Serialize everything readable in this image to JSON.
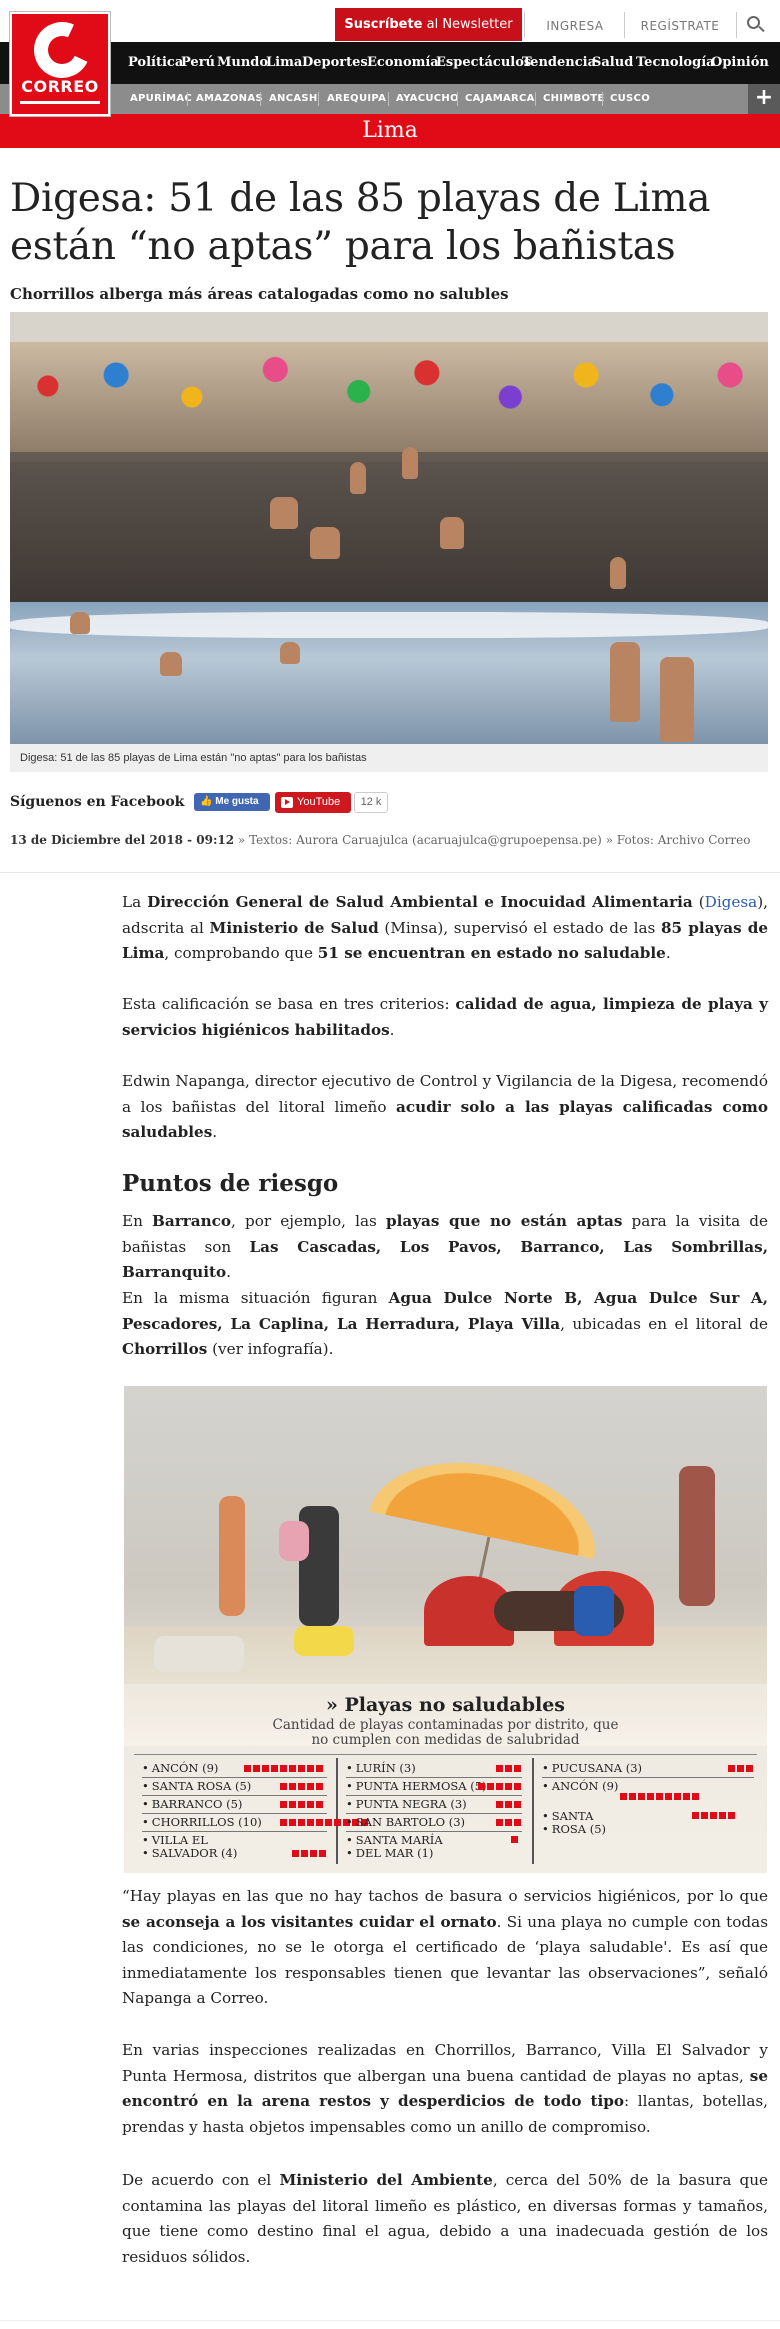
{
  "brand": {
    "name": "CORREO",
    "letter": "C"
  },
  "topbar": {
    "newsletter_strong": "Suscríbete",
    "newsletter_rest": " al Newsletter",
    "login": "INGRESA",
    "register": "REGÍSTRATE"
  },
  "nav": {
    "items": [
      "Política",
      "Perú",
      "Mundo",
      "Lima",
      "Deportes",
      "Economía",
      "Espectáculos",
      "Tendencia",
      "Salud",
      "Tecnología",
      "Opinión"
    ]
  },
  "subnav": {
    "items": [
      "APURÍMAC",
      "AMAZONAS",
      "ANCASH",
      "AREQUIPA",
      "AYACUCHO",
      "CAJAMARCA",
      "CHIMBOTE",
      "CUSCO"
    ],
    "more": "+"
  },
  "section": "Lima",
  "article": {
    "headline": "Digesa: 51 de las 85 playas de Lima están “no aptas” para los bañistas",
    "subhead": "Chorrillos alberga más áreas catalogadas como no salubles",
    "photo_caption": "Digesa: 51 de las 85 playas de Lima están \"no aptas\" para los bañistas",
    "follow_label": "Síguenos en Facebook",
    "fb_like": "Me gusta",
    "youtube_label": "YouTube",
    "youtube_count": "12 k",
    "date": "13 de Diciembre del 2018 - 09:12",
    "byline_rest": " » Textos: Aurora Caruajulca (acaruajulca@grupoepensa.pe) » Fotos: Archivo Correo",
    "h2": "Puntos de riesgo"
  },
  "paragraphs": {
    "p1": {
      "a": "La ",
      "b": "Dirección General de Salud Ambiental e Inocuidad Alimentaria",
      "c": " (",
      "link": "Digesa",
      "d": "), adscrita al ",
      "e": "Ministerio de Salud",
      "f": " (Minsa), supervisó el estado de las ",
      "g": "85 playas de Lima",
      "h": ", comprobando que ",
      "i": "51 se encuentran en estado no saludable",
      "j": "."
    },
    "p2": {
      "a": "Esta calificación se basa en tres criterios: ",
      "b": "calidad de agua, limpieza de playa y servicios higiénicos habilitados",
      "c": "."
    },
    "p3": {
      "a": "Edwin Napanga, director ejecutivo de Control y Vigilancia de la Digesa, recomendó a los bañistas del litoral limeño ",
      "b": "acudir solo a las playas calificadas como saludables",
      "c": "."
    },
    "p4": {
      "a": "En ",
      "b": "Barranco",
      "c": ", por ejemplo, las ",
      "d": "playas que no están aptas",
      "e": " para la visita de bañistas son ",
      "f": "Las Cascadas, Los Pavos, Barranco, Las Sombrillas, Barranquito",
      "g": "."
    },
    "p5": {
      "a": "En la misma situación figuran ",
      "b": "Agua Dulce Norte B, Agua Dulce Sur A, Pescadores, La Caplina, La Herradura, Playa Villa",
      "c": ", ubicadas en el litoral de ",
      "d": "Chorrillos",
      "e": " (ver infografía)."
    },
    "p6": {
      "a": "“Hay playas en las que no hay tachos de basura o servicios higiénicos, por lo que ",
      "b": "se aconseja a los visitantes cuidar el ornato",
      "c": ". Si una playa no cumple con todas las condiciones, no se le otorga el certificado de ‘playa saludable'. Es así que inmediatamente los responsables tienen que levantar las observaciones”, señaló Napanga a Correo."
    },
    "p7": {
      "a": "En varias inspecciones realizadas en Chorrillos, Barranco, Villa El Salvador y Punta Hermosa, distritos que albergan una buena cantidad de playas no aptas, ",
      "b": "se encontró en la arena restos y desperdicios de todo tipo",
      "c": ": llantas, botellas, prendas y hasta objetos impensables como un anillo de compromiso."
    },
    "p8": {
      "a": "De acuerdo con el ",
      "b": "Ministerio del Ambiente",
      "c": ", cerca del 50% de la basura que contamina las playas del litoral limeño es plástico, en diversas formas y tamaños, que tiene como destino final el agua, debido a una inadecuada gestión de los residuos sólidos."
    }
  },
  "infographic": {
    "title": "» Playas no saludables",
    "subtitle": "Cantidad de playas contaminadas por distrito, que no cumplen con medidas de salubridad",
    "columns": [
      [
        {
          "label": "ANCÓN (9)",
          "count": 9
        },
        {
          "label": "SANTA ROSA (5)",
          "count": 5
        },
        {
          "label": "BARRANCO (5)",
          "count": 5
        },
        {
          "label": "CHORRILLOS (10)",
          "count": 10
        },
        {
          "label": "VILLA EL",
          "label2": "SALVADOR (4)",
          "count": 4
        }
      ],
      [
        {
          "label": "LURÍN (3)",
          "count": 3
        },
        {
          "label": "PUNTA HERMOSA (5)",
          "count": 5
        },
        {
          "label": "PUNTA NEGRA (3)",
          "count": 3
        },
        {
          "label": "SAN BARTOLO (3)",
          "count": 3
        },
        {
          "label": "SANTA MARÍA",
          "label2": "DEL MAR (1)",
          "count": 1
        }
      ],
      [
        {
          "label": "PUCUSANA (3)",
          "count": 3
        },
        {
          "label": "ANCÓN (9)",
          "count": 9
        },
        {
          "label": "SANTA",
          "label2": "ROSA (5)",
          "count": 5
        }
      ]
    ]
  },
  "colors": {
    "brand_red": "#e10b17",
    "nav_bg": "#111111",
    "subnav_bg": "#8c8c8c",
    "link": "#2a5db0"
  },
  "icons": {
    "search": "search-icon",
    "youtube": "youtube-play-icon",
    "facebook": "facebook-like-icon"
  }
}
